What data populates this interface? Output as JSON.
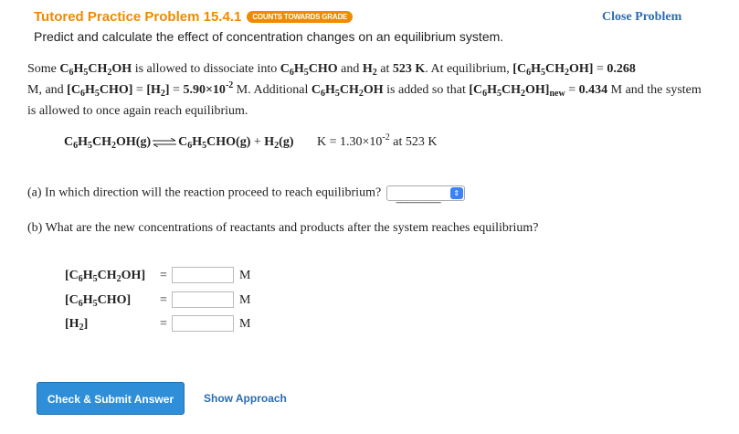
{
  "header": {
    "title": "Tutored Practice Problem 15.4.1",
    "badge": "COUNTS TOWARDS GRADE",
    "subtitle": "Predict and calculate the effect of concentration changes on an equilibrium system.",
    "close_label": "Close Problem"
  },
  "problem": {
    "s1": "Some ",
    "s2": " is allowed to dissociate into ",
    "s3": " and ",
    "s4": " at ",
    "temp": "523 K",
    "s5": ". At equilibrium, ",
    "s6": " = ",
    "c1": "0.268",
    "s7": " M, and ",
    "s8": " = ",
    "s9": " = ",
    "c2": "5.90×10",
    "c2exp": "-2",
    "s10": " M. Additional ",
    "s11": " is added so that ",
    "s12": " = ",
    "c3": "0.434",
    "s13": " M and the system is allowed to once again reach equilibrium.",
    "new_sub": "new"
  },
  "equation": {
    "plus": " + ",
    "k_label": "K = 1.30×10",
    "k_exp": "-2",
    "k_temp": " at 523 K"
  },
  "part_a": {
    "question": "(a) In which direction will the reaction proceed to reach equilibrium?",
    "select_value": "________"
  },
  "part_b": {
    "question": "(b) What are the new concentrations of reactants and products after the system reaches equilibrium?",
    "rows": [
      {
        "eq": "=",
        "unit": "M",
        "value": ""
      },
      {
        "eq": "=",
        "unit": "M",
        "value": ""
      },
      {
        "eq": "=",
        "unit": "M",
        "value": ""
      }
    ]
  },
  "actions": {
    "submit_label": "Check & Submit Answer",
    "approach_label": "Show Approach"
  }
}
